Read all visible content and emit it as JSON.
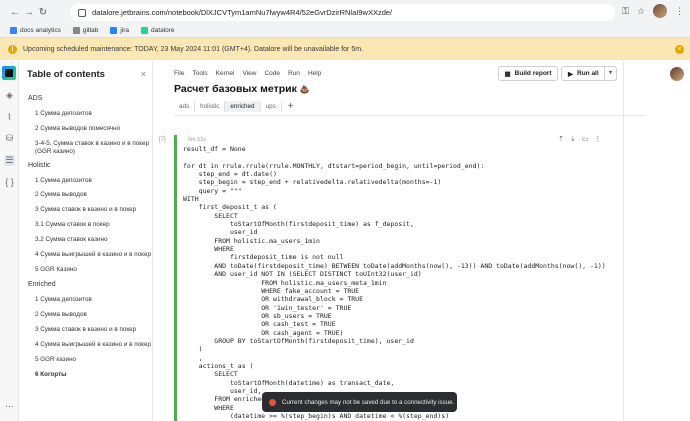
{
  "browser": {
    "url": "datalore.jetbrains.com/notebook/DlXJCVTym1amNu7lwyw4R4/52eGvrDzirRNlaI9wXXzde/",
    "nav": [
      "back-arrow-icon",
      "forward-arrow-icon",
      "reload-icon"
    ]
  },
  "bookmarks": [
    {
      "label": "docs analytics",
      "color": "#3b82f6"
    },
    {
      "label": "gitlab",
      "color": "#888888"
    },
    {
      "label": "jira",
      "color": "#2684ff"
    },
    {
      "label": "datalore",
      "color": "#21d789"
    }
  ],
  "banner": {
    "text": "Upcoming scheduled maintenance: TODAY, 23 May 2024 11:01 (GMT+4). Datalore will be unavailable for 5m.",
    "warn_glyph": "!",
    "close_glyph": "×"
  },
  "toc": {
    "title": "Table of contents",
    "close_glyph": "×",
    "sections": [
      {
        "heading": "ADS",
        "items": [
          "1 Сумма депозитов",
          "2 Сумма выводов помесячно",
          "3-4-5. Сумма ставок в казино и в покер",
          "(GGR казино)"
        ]
      },
      {
        "heading": "Holistic",
        "items": [
          "1 Сумма депозитов",
          "2 Сумма выводов",
          "3 Сумма ставок в казино и в покер",
          "3.1 Сумма ставок в покер",
          "3.2 Сумма ставок казино",
          "4 Сумма выигрышей в казино и в покер",
          "5 GGR Казино"
        ]
      },
      {
        "heading": "Enriched",
        "items": [
          "1 Сумма депозитов",
          "2 Сумма выводов",
          "3 Сумма ставок в казино и в покер",
          "4 Сумма выигрышей в казино и в покер",
          "5 GGR казино",
          "6 Когорты"
        ]
      }
    ]
  },
  "notebook": {
    "menu": [
      "File",
      "Tools",
      "Kernel",
      "View",
      "Code",
      "Run",
      "Help"
    ],
    "title": "Расчет базовых метрик",
    "title_emoji": "💩",
    "tabs": [
      "ads",
      "holistic",
      "enriched",
      "ups"
    ],
    "active_tab": "enriched",
    "add_tab_glyph": "+",
    "build_report_label": "Build report",
    "run_all_label": "Run all"
  },
  "cell": {
    "number": "[7]",
    "meta": "6m 51s",
    "code_lines": [
      "result_df = None",
      "",
      "for dt in rrule.rrule(rrule.MONTHLY, dtstart=period_begin, until=period_end):",
      "    step_end = dt.date()",
      "    step_begin = step_end + relativedelta.relativedelta(months=-1)",
      "    query = \"\"\"",
      "WITH",
      "    first_deposit_t as (",
      "        SELECT",
      "            toStartOfMonth(firstdeposit_time) as f_deposit,",
      "            user_id",
      "        FROM holistic.ma_users_1min",
      "        WHERE",
      "            firstdeposit_time is not null",
      "        AND toDate(firstdeposit_time) BETWEEN toDate(addMonths(now(), -13)) AND toDate(addMonths(now(), -1))",
      "        AND user_id NOT IN (SELECT DISTINCT toUInt32(user_id)",
      "                    FROM holistic.ma_users_meta_1min",
      "                    WHERE fake_account = TRUE",
      "                    OR withdrawal_block = TRUE",
      "                    OR '1win_tester' = TRUE",
      "                    OR sb_users = TRUE",
      "                    OR cash_test = TRUE",
      "                    OR cash_agent = TRUE)",
      "        GROUP BY toStartOfMonth(firstdeposit_time), user_id",
      "    )",
      "    ,",
      "    actions_t as (",
      "        SELECT",
      "            toStartOfMonth(datetime) as transact_date,",
      "            user_id,",
      "        FROM enriched.transactions",
      "        WHERE",
      "            (datetime >= %(step_begin)s AND datetime < %(step_end)s)"
    ]
  },
  "toast": {
    "text": "Current changes may not be saved due to a connectivity issue."
  }
}
